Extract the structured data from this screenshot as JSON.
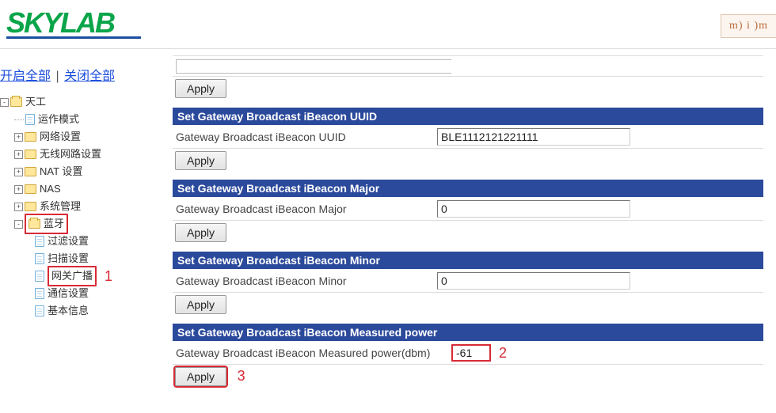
{
  "brand": {
    "name": "SKYLAB",
    "corner_text": "m) i )m"
  },
  "toplinks": {
    "open_all": "开启全部",
    "sep": "|",
    "close_all": "关闭全部"
  },
  "tree": {
    "root": "天工",
    "items": [
      "运作模式",
      "网络设置",
      "无线网路设置",
      "NAT 设置",
      "NAS",
      "系统管理",
      "蓝牙"
    ],
    "bt_children": [
      "过滤设置",
      "扫描设置",
      "网关广播",
      "通信设置",
      "基本信息"
    ]
  },
  "annotations": {
    "a1": "1",
    "a2": "2",
    "a3": "3"
  },
  "buttons": {
    "apply": "Apply"
  },
  "sections": {
    "uuid": {
      "title": "Set Gateway Broadcast iBeacon UUID",
      "label": "Gateway Broadcast iBeacon UUID",
      "value": "BLE1112121221111"
    },
    "major": {
      "title": "Set Gateway Broadcast iBeacon Major",
      "label": "Gateway Broadcast iBeacon Major",
      "value": "0"
    },
    "minor": {
      "title": "Set Gateway Broadcast iBeacon Minor",
      "label": "Gateway Broadcast iBeacon Minor",
      "value": "0"
    },
    "power": {
      "title": "Set Gateway Broadcast iBeacon Measured power",
      "label": "Gateway Broadcast iBeacon Measured power(dbm)",
      "value": "-61"
    }
  }
}
